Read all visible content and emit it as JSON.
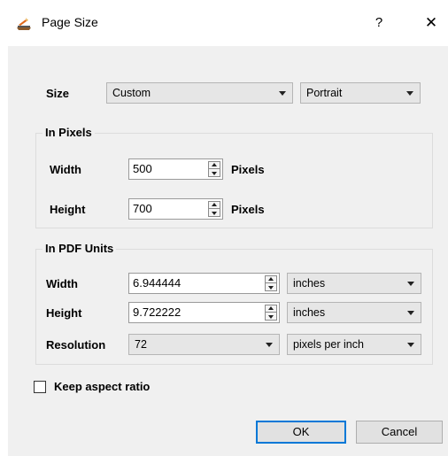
{
  "window": {
    "title": "Page Size",
    "help_glyph": "?",
    "close_glyph": "✕"
  },
  "size": {
    "label": "Size",
    "preset_value": "Custom",
    "orientation_value": "Portrait"
  },
  "pixels_group": {
    "title": "In Pixels",
    "width_label": "Width",
    "width_value": "500",
    "width_unit": "Pixels",
    "height_label": "Height",
    "height_value": "700",
    "height_unit": "Pixels"
  },
  "pdf_group": {
    "title": "In PDF Units",
    "width_label": "Width",
    "width_value": "6.944444",
    "width_unit": "inches",
    "height_label": "Height",
    "height_value": "9.722222",
    "height_unit": "inches",
    "resolution_label": "Resolution",
    "resolution_value": "72",
    "resolution_unit": "pixels per inch"
  },
  "keep_aspect": {
    "label": "Keep aspect ratio",
    "checked": false
  },
  "buttons": {
    "ok": "OK",
    "cancel": "Cancel"
  },
  "colors": {
    "dialog_bg": "#f0f0f0",
    "default_button_border": "#0078d7"
  }
}
